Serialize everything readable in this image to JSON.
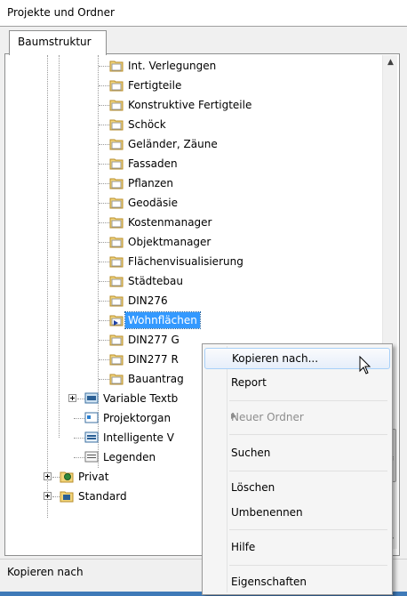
{
  "window": {
    "title": "Projekte und Ordner"
  },
  "tabs": [
    {
      "label": "Baumstruktur"
    }
  ],
  "tree": {
    "items": [
      {
        "label": "Int. Verlegungen"
      },
      {
        "label": "Fertigteile"
      },
      {
        "label": "Konstruktive Fertigteile"
      },
      {
        "label": "Schöck"
      },
      {
        "label": "Geländer, Zäune"
      },
      {
        "label": "Fassaden"
      },
      {
        "label": "Pflanzen"
      },
      {
        "label": "Geodäsie"
      },
      {
        "label": "Kostenmanager"
      },
      {
        "label": "Objektmanager"
      },
      {
        "label": "Flächenvisualisierung"
      },
      {
        "label": "Städtebau"
      },
      {
        "label": "DIN276"
      },
      {
        "label": "Wohnflächen"
      },
      {
        "label": "DIN277 G"
      },
      {
        "label": "DIN277 R"
      },
      {
        "label": "Bauantrag"
      },
      {
        "label": "Variable Textb"
      },
      {
        "label": "Projektorgan"
      },
      {
        "label": "Intelligente V"
      },
      {
        "label": "Legenden"
      },
      {
        "label": "Privat"
      },
      {
        "label": "Standard"
      }
    ],
    "selected_label": "Wohnflächen"
  },
  "context_menu": {
    "items": [
      {
        "label": "Kopieren nach...",
        "state": "hover"
      },
      {
        "label": "Report"
      },
      {
        "label": "Neuer Ordner",
        "state": "disabled",
        "submenu": true
      },
      {
        "label": "Suchen"
      },
      {
        "label": "Löschen"
      },
      {
        "label": "Umbenennen"
      },
      {
        "label": "Hilfe"
      },
      {
        "label": "Eigenschaften"
      }
    ]
  },
  "status_bar": {
    "text": "Kopieren nach"
  },
  "icons": {
    "folder": "folder-icon",
    "expander": "expand-plus-icon",
    "submenu_arrow": "chevron-right-icon",
    "cursor": "mouse-pointer-icon"
  },
  "colors": {
    "selection": "#3399ff",
    "folder_yellow": "#f3d57a",
    "menu_hover_border": "#a8d0f8"
  }
}
